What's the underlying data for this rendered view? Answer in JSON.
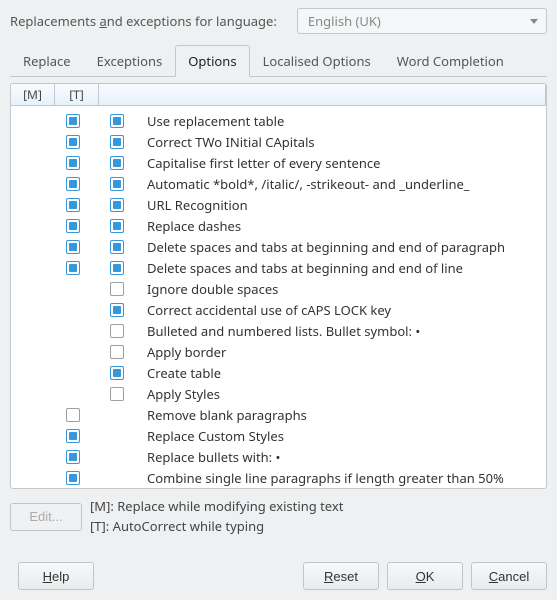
{
  "lang": {
    "label_pre": "Replacements ",
    "label_u": "a",
    "label_post": "nd exceptions for language:",
    "value": "English (UK)"
  },
  "tabs": [
    {
      "label": "Replace",
      "active": false
    },
    {
      "label": "Exceptions",
      "active": false
    },
    {
      "label": "Options",
      "active": true
    },
    {
      "label": "Localised Options",
      "active": false
    },
    {
      "label": "Word Completion",
      "active": false
    }
  ],
  "columns": {
    "m": "[M]",
    "t": "[T]",
    "desc": ""
  },
  "options": [
    {
      "m": true,
      "t": true,
      "desc": "Use replacement table"
    },
    {
      "m": true,
      "t": true,
      "desc": "Correct TWo INitial CApitals"
    },
    {
      "m": true,
      "t": true,
      "desc": "Capitalise first letter of every sentence"
    },
    {
      "m": true,
      "t": true,
      "desc": "Automatic *bold*, /italic/, -strikeout- and _underline_"
    },
    {
      "m": true,
      "t": true,
      "desc": "URL Recognition"
    },
    {
      "m": true,
      "t": true,
      "desc": "Replace dashes"
    },
    {
      "m": true,
      "t": true,
      "desc": "Delete spaces and tabs at beginning and end of paragraph"
    },
    {
      "m": true,
      "t": true,
      "desc": "Delete spaces and tabs at beginning and end of line"
    },
    {
      "m": null,
      "t": false,
      "desc": "Ignore double spaces"
    },
    {
      "m": null,
      "t": true,
      "desc": "Correct accidental use of cAPS LOCK key"
    },
    {
      "m": null,
      "t": false,
      "desc": "Bulleted and numbered lists. Bullet symbol: •"
    },
    {
      "m": null,
      "t": false,
      "desc": "Apply border"
    },
    {
      "m": null,
      "t": true,
      "desc": "Create table"
    },
    {
      "m": null,
      "t": false,
      "desc": "Apply Styles"
    },
    {
      "m": false,
      "t": null,
      "desc": "Remove blank paragraphs"
    },
    {
      "m": true,
      "t": null,
      "desc": "Replace Custom Styles"
    },
    {
      "m": true,
      "t": null,
      "desc": "Replace bullets with: •"
    },
    {
      "m": true,
      "t": null,
      "desc": "Combine single line paragraphs if length greater than 50%"
    }
  ],
  "legend": {
    "edit": "Edit...",
    "line1": "[M]: Replace while modifying existing text",
    "line2": "[T]: AutoCorrect while typing"
  },
  "footer": {
    "help_u": "H",
    "help_rest": "elp",
    "reset_u": "R",
    "reset_rest": "eset",
    "ok_u": "O",
    "ok_rest": "K",
    "cancel_u": "C",
    "cancel_rest": "ancel"
  }
}
